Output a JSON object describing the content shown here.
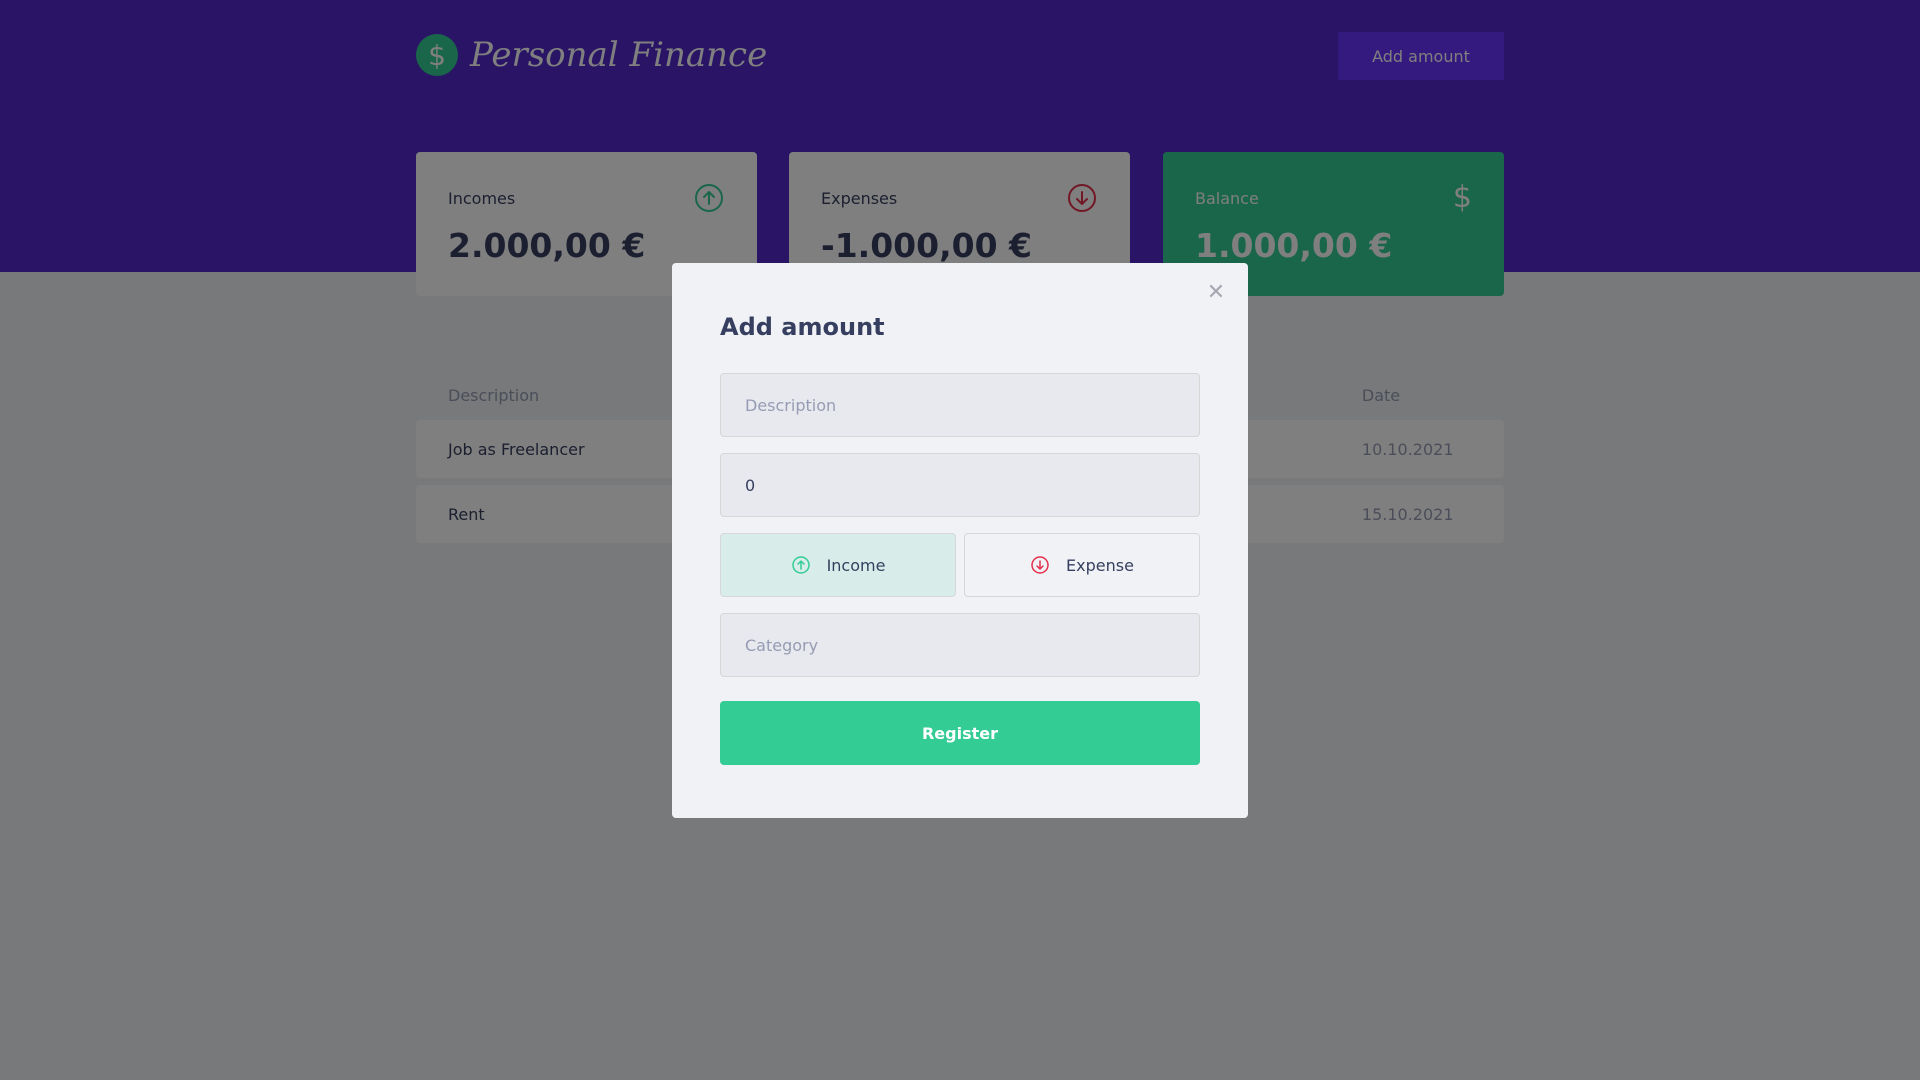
{
  "app": {
    "title": "Personal Finance",
    "logo_symbol": "$",
    "add_amount_label": "Add amount"
  },
  "summary": {
    "incomes": {
      "label": "Incomes",
      "value": "2.000,00 €",
      "icon": "arrow-up-circle-icon"
    },
    "expenses": {
      "label": "Expenses",
      "value": "-1.000,00 €",
      "icon": "arrow-down-circle-icon"
    },
    "balance": {
      "label": "Balance",
      "value": "1.000,00 €",
      "icon": "dollar-icon",
      "symbol": "$"
    }
  },
  "table": {
    "headers": {
      "description": "Description",
      "amount": "",
      "category": "",
      "date": "Date"
    },
    "rows": [
      {
        "description": "Job as Freelancer",
        "date": "10.10.2021"
      },
      {
        "description": "Rent",
        "date": "15.10.2021"
      }
    ]
  },
  "modal": {
    "title": "Add amount",
    "close_symbol": "✕",
    "description_placeholder": "Description",
    "amount_value": "0",
    "income_label": "Income",
    "expense_label": "Expense",
    "category_placeholder": "Category",
    "register_label": "Register"
  },
  "colors": {
    "header": "#5429cc",
    "accent": "#6933ff",
    "income": "#33cc95",
    "expense": "#e52e4d",
    "text": "#363f5f"
  }
}
